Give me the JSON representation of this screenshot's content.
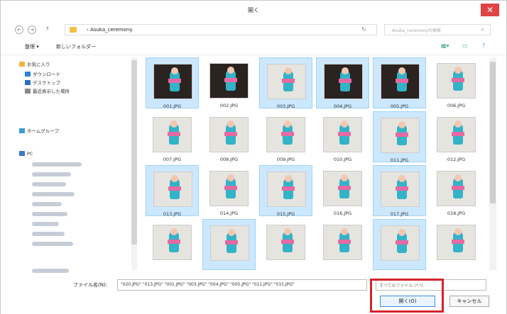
{
  "window": {
    "title": "開く",
    "close_glyph": "✕"
  },
  "address": {
    "back_glyph": "←",
    "forward_glyph": "→",
    "up_glyph": "↑",
    "path": "› Asuka_ceremony",
    "search_placeholder": "Asuka_ceremonyの検索",
    "refresh_glyph": "↻",
    "search_glyph": "⌕"
  },
  "toolbar": {
    "organize_label": "整理 ▾",
    "new_folder_label": "新しいフォルダー"
  },
  "nav": {
    "favorites": "お気に入り",
    "downloads": "ダウンロード",
    "desktop": "デスクトップ",
    "recent": "最近表示した場所",
    "homegroup": "ホームグループ",
    "pc": "PC"
  },
  "files": [
    {
      "name": "001.JPG",
      "selected": true,
      "tone": "dark"
    },
    {
      "name": "002.JPG",
      "selected": false,
      "tone": "dark"
    },
    {
      "name": "003.JPG",
      "selected": true,
      "tone": "light"
    },
    {
      "name": "004.JPG",
      "selected": true,
      "tone": "dark"
    },
    {
      "name": "005.JPG",
      "selected": true,
      "tone": "dark"
    },
    {
      "name": "006.JPG",
      "selected": false,
      "tone": "light"
    },
    {
      "name": "007.JPG",
      "selected": false,
      "tone": "light"
    },
    {
      "name": "008.JPG",
      "selected": false,
      "tone": "light"
    },
    {
      "name": "009.JPG",
      "selected": false,
      "tone": "light"
    },
    {
      "name": "010.JPG",
      "selected": false,
      "tone": "light"
    },
    {
      "name": "011.JPG",
      "selected": true,
      "tone": "light"
    },
    {
      "name": "012.JPG",
      "selected": false,
      "tone": "light"
    },
    {
      "name": "013.JPG",
      "selected": true,
      "tone": "light"
    },
    {
      "name": "014.JPG",
      "selected": false,
      "tone": "light"
    },
    {
      "name": "015.JPG",
      "selected": true,
      "tone": "light"
    },
    {
      "name": "016.JPG",
      "selected": false,
      "tone": "light"
    },
    {
      "name": "017.JPG",
      "selected": true,
      "tone": "light"
    },
    {
      "name": "018.JPG",
      "selected": false,
      "tone": "light"
    },
    {
      "name": "",
      "selected": false,
      "tone": "light"
    },
    {
      "name": "",
      "selected": true,
      "tone": "light"
    },
    {
      "name": "",
      "selected": false,
      "tone": "light"
    },
    {
      "name": "",
      "selected": false,
      "tone": "light"
    },
    {
      "name": "",
      "selected": true,
      "tone": "light"
    },
    {
      "name": "",
      "selected": false,
      "tone": "light"
    }
  ],
  "bottom": {
    "filename_label": "ファイル名(N):",
    "filename_value": "\"020.JPG\" \"013.JPG\" \"001.JPG\" \"003.JPG\" \"004.JPG\" \"005.JPG\" \"011.JPG\" \"015.JPG\"",
    "filetype_value": "すべてのファイル (*.*)",
    "open_label": "開く(O)",
    "cancel_label": "キャンセル"
  },
  "colors": {
    "selection": "#cce8ff",
    "highlight": "#d3242b",
    "close": "#e04343"
  }
}
